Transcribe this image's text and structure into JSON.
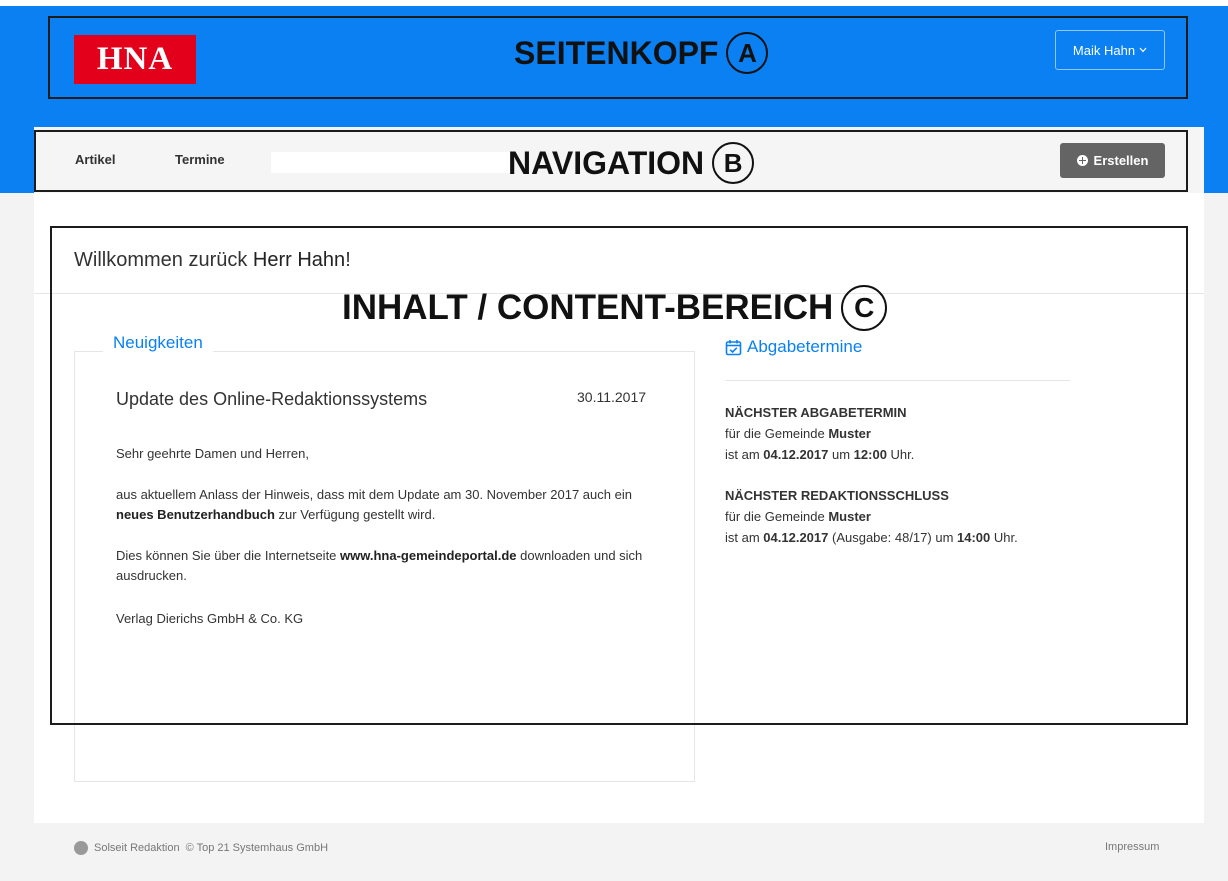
{
  "header": {
    "logo_text": "HNA",
    "user_menu_label": "Maik Hahn"
  },
  "navigation": {
    "items": [
      {
        "label": "Artikel"
      },
      {
        "label": "Termine"
      }
    ],
    "create_button_label": "Erstellen"
  },
  "welcome": {
    "prefix": "Willkommen zurück ",
    "name": "Herr Hahn",
    "suffix": "!"
  },
  "news": {
    "section_title": "Neuigkeiten",
    "article_title": "Update des Online-Redaktionssystems",
    "article_date": "30.11.2017",
    "salutation": "Sehr geehrte Damen und Herren,",
    "para1_a": "aus aktuellem Anlass der Hinweis, dass mit dem Update am 30. November 2017 auch ein ",
    "para1_b": "neues Benutzerhandbuch",
    "para1_c": " zur Verfügung gestellt wird.",
    "para2_a": "Dies können Sie über die Internetseite ",
    "para2_b": "www.hna-gemeindeportal.de",
    "para2_c": " downloaden und sich ausdrucken.",
    "signature": "Verlag Dierichs GmbH & Co. KG"
  },
  "deadlines": {
    "section_title": "Abgabetermine",
    "next_submission": {
      "heading": "NÄCHSTER ABGABETERMIN",
      "community_prefix": "für die Gemeinde ",
      "community": "Muster",
      "date_prefix": "ist am ",
      "date": "04.12.2017",
      "time_prefix": " um ",
      "time": "12:00",
      "time_suffix": " Uhr."
    },
    "next_editorial_deadline": {
      "heading": "NÄCHSTER REDAKTIONSSCHLUSS",
      "community_prefix": "für die Gemeinde ",
      "community": "Muster",
      "date_prefix": "ist am ",
      "date": "04.12.2017",
      "edition_text": " (Ausgabe: 48/17) um ",
      "time": "14:00",
      "time_suffix": " Uhr."
    }
  },
  "footer": {
    "brand": "Solseit Redaktion",
    "copyright": "© Top 21 Systemhaus GmbH",
    "impressum_label": "Impressum"
  },
  "annotations": {
    "header_label": "SEITENKOPF",
    "header_letter": "A",
    "nav_label": "NAVIGATION",
    "nav_letter": "B",
    "content_label": "INHALT / CONTENT-BEREICH",
    "content_letter": "C"
  },
  "colors": {
    "brand_blue": "#0a80f2",
    "logo_red": "#e3001b",
    "create_button": "#646464",
    "annotation_frame": "#1c1c1c"
  }
}
